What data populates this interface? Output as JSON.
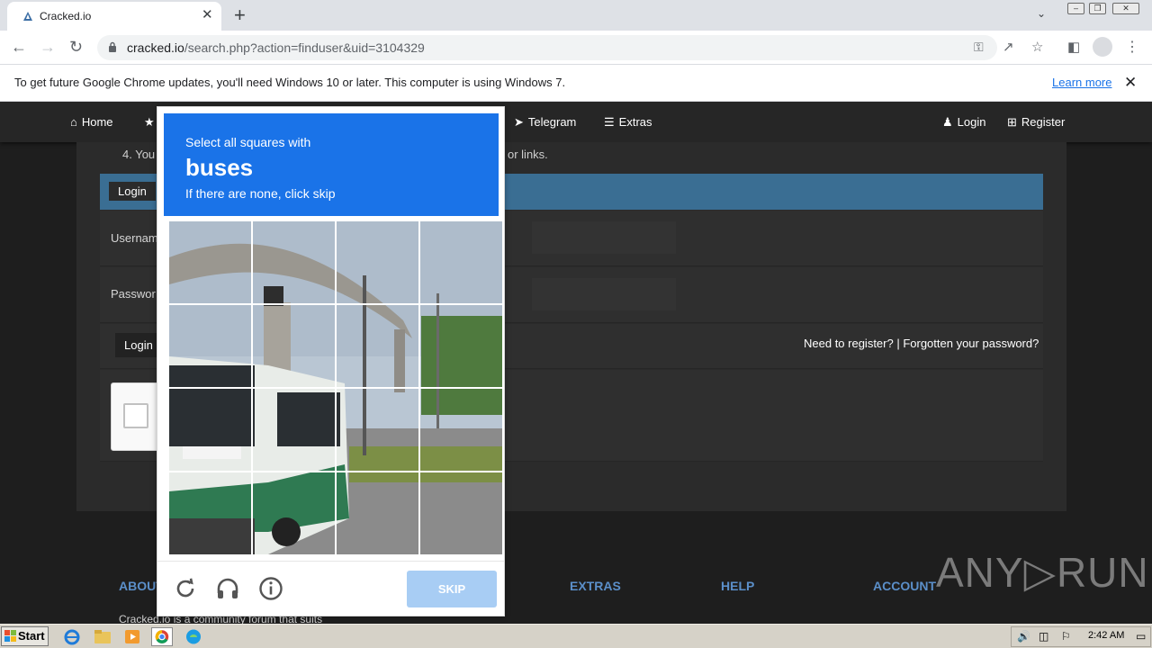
{
  "browser": {
    "tab_title": "Cracked.io",
    "tab_close": "✕",
    "new_tab": "+",
    "url_host": "cracked.io",
    "url_path": "/search.php?action=finduser&uid=3104329"
  },
  "infobar": {
    "message": "To get future Google Chrome updates, you'll need Windows 10 or later. This computer is using Windows 7.",
    "link": "Learn more",
    "close": "✕"
  },
  "site": {
    "nav": {
      "home": "Home",
      "telegram": "Telegram",
      "extras": "Extras",
      "login": "Login",
      "register": "Register"
    },
    "rules_line": "4. You",
    "rules_tail": "or links.",
    "login_tab": "Login",
    "username_label": "Usernam",
    "password_label": "Passwor",
    "login_button": "Login",
    "need_register": "Need to register? | Forgotten your password?",
    "footer": {
      "about": "ABOUT",
      "extras": "EXTRAS",
      "help": "HELP",
      "account": "ACCOUNT",
      "about_text": "Cracked.io is a community forum that suits"
    },
    "watermark": "ANY▷RUN"
  },
  "captcha": {
    "prompt_top": "Select all squares with",
    "target": "buses",
    "prompt_bottom": "If there are none, click skip",
    "skip": "SKIP",
    "icons": [
      "refresh-icon",
      "headphones-icon",
      "info-icon"
    ]
  },
  "taskbar": {
    "start": "Start",
    "clock": "2:42 AM"
  },
  "colors": {
    "captcha_blue": "#1a73e8",
    "skip_disabled": "#a8cdf4",
    "site_header": "#3a6e93",
    "footer_heading": "#5b8fc9"
  }
}
